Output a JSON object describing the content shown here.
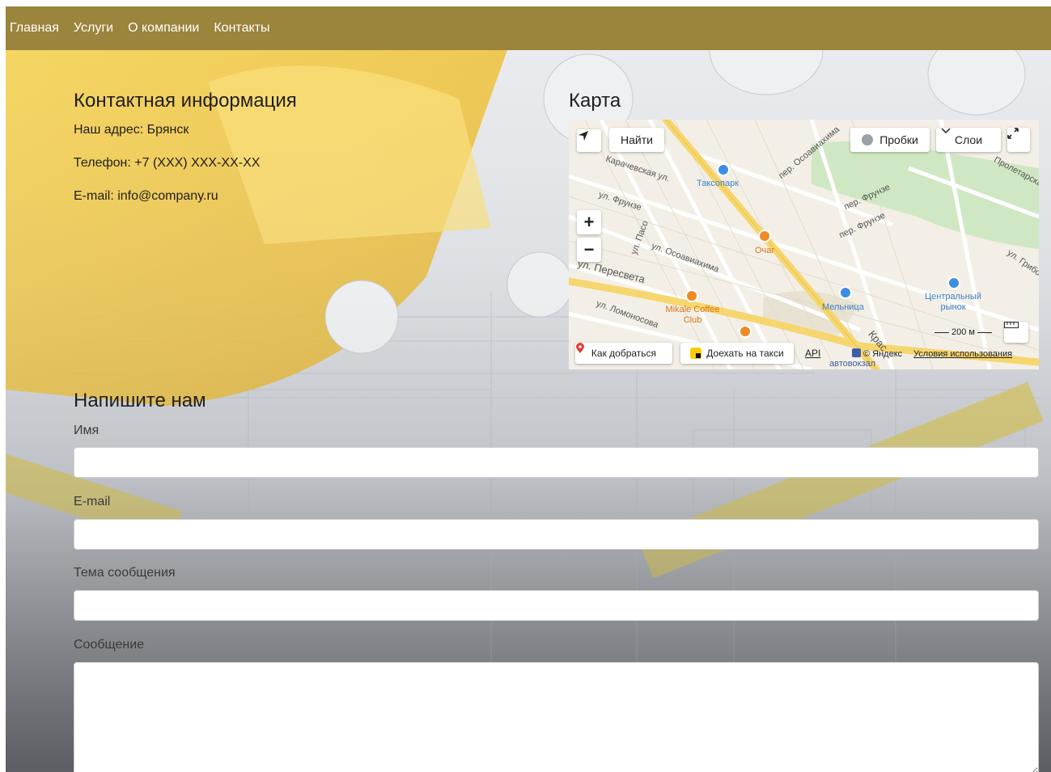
{
  "nav": {
    "items": [
      "Главная",
      "Услуги",
      "О компании",
      "Контакты"
    ]
  },
  "contacts": {
    "title": "Контактная информация",
    "address": "Наш адрес: Брянск",
    "phone": "Телефон: +7 (XXX) XXX-XX-XX",
    "email": "E-mail: info@company.ru"
  },
  "map": {
    "title": "Карта",
    "find_button": "Найти",
    "traffic_button": "Пробки",
    "layers_button": "Слои",
    "zoom_in": "+",
    "zoom_out": "−",
    "scale": "200 м",
    "route_button": "Как добраться",
    "taxi_button": "Доехать на такси",
    "api_link": "API",
    "copyright": "© Яндекс",
    "terms_link": "Условия использования",
    "streets": {
      "s1": "Карачевская ул.",
      "s2": "ул. Фрунзе",
      "s3": "ул. Пасо",
      "s4": "ул. Осоавиахима",
      "s5": "ул. Пересвета",
      "s6": "ул. Ломоносова",
      "s7": "пер. Осоавиахима",
      "s8": "пер. Фрунзе",
      "s9": "пер. Фрунзе",
      "s10": "Пролетарская",
      "s11": "ул. Грибоедова",
      "s12": "Крас",
      "s13": "автовокзал"
    },
    "pois": {
      "p1": "Таксопарк",
      "p2": "Очаг",
      "p3": "Мельница",
      "p4": "Центральный рынок",
      "p5": "Mikale Coffee Club"
    },
    "colors": {
      "road_main": "#f6d66e",
      "road_minor": "#ffffff",
      "park": "#cfe8c3",
      "land": "#f3efe6",
      "poi_blue": "#3d8ee3",
      "poi_orange": "#f08a24",
      "poi_purple": "#7b6fe0"
    }
  },
  "form": {
    "title": "Напишите нам",
    "name_label": "Имя",
    "email_label": "E-mail",
    "subject_label": "Тема сообщения",
    "message_label": "Сообщение"
  },
  "colors": {
    "navbar": "#9b843b",
    "nav_text": "#ffffff"
  }
}
